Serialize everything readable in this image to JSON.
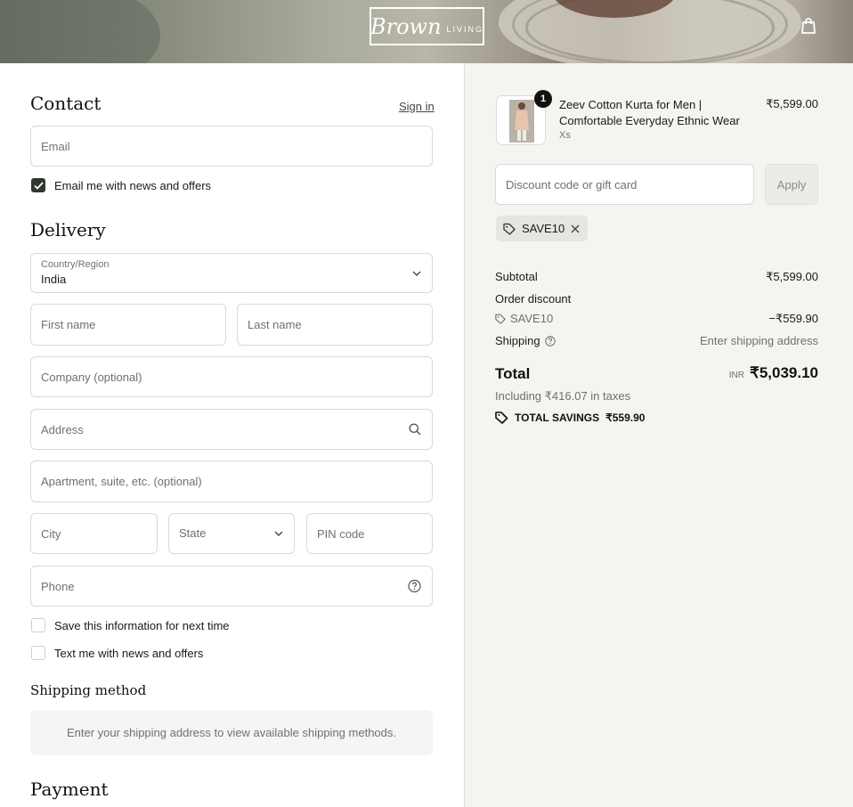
{
  "header": {
    "brand": "Brown",
    "brand_sub": "LIVING",
    "cart_icon": "shopping-bag-icon"
  },
  "contact": {
    "heading": "Contact",
    "sign_in": "Sign in",
    "email_placeholder": "Email",
    "email_news_label": "Email me with news and offers",
    "email_news_checked": true
  },
  "delivery": {
    "heading": "Delivery",
    "country_label": "Country/Region",
    "country_value": "India",
    "first_name": "First name",
    "last_name": "Last name",
    "company": "Company (optional)",
    "address": "Address",
    "apartment": "Apartment, suite, etc. (optional)",
    "city": "City",
    "state": "State",
    "pin": "PIN code",
    "phone": "Phone",
    "save_info_label": "Save this information for next time",
    "text_news_label": "Text me with news and offers"
  },
  "shipping_method": {
    "heading": "Shipping method",
    "message": "Enter your shipping address to view available shipping methods."
  },
  "payment": {
    "heading": "Payment"
  },
  "order": {
    "item": {
      "quantity": "1",
      "name": "Zeev Cotton Kurta for Men | Comfortable Everyday Ethnic Wear",
      "variant": "Xs",
      "price": "₹5,599.00"
    },
    "discount_placeholder": "Discount code or gift card",
    "apply_label": "Apply",
    "applied_code": "SAVE10",
    "subtotal_label": "Subtotal",
    "subtotal_value": "₹5,599.00",
    "order_discount_label": "Order discount",
    "discount_code": "SAVE10",
    "discount_value": "−₹559.90",
    "shipping_label": "Shipping",
    "shipping_value": "Enter shipping address",
    "total_label": "Total",
    "currency": "INR",
    "total_value": "₹5,039.10",
    "taxes_note": "Including ₹416.07 in taxes",
    "savings_label": "TOTAL SAVINGS",
    "savings_value": "₹559.90"
  },
  "colors": {
    "accent_dark_green": "#2f3a2c",
    "summary_bg": "#f5f4ee"
  }
}
